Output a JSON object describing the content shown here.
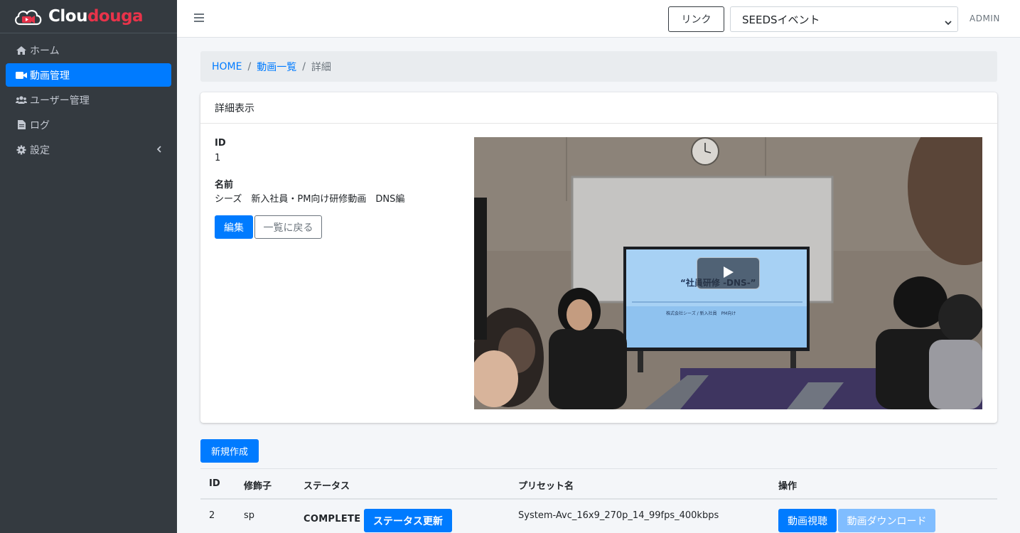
{
  "brand": {
    "name_white": "Clou",
    "name_red": "douga"
  },
  "sidebar": {
    "items": [
      {
        "label": "ホーム",
        "icon": "home-icon",
        "active": false
      },
      {
        "label": "動画管理",
        "icon": "video-camera-icon",
        "active": true
      },
      {
        "label": "ユーザー管理",
        "icon": "users-icon",
        "active": false
      },
      {
        "label": "ログ",
        "icon": "file-icon",
        "active": false
      },
      {
        "label": "設定",
        "icon": "gear-icon",
        "active": false
      }
    ]
  },
  "topbar": {
    "link_label": "リンク",
    "event_select_value": "SEEDSイベント",
    "user_label": "ADMIN"
  },
  "breadcrumb": {
    "home": "HOME",
    "list": "動画一覧",
    "current": "詳細",
    "separator": "/"
  },
  "detail": {
    "card_title": "詳細表示",
    "id_label": "ID",
    "id_value": "1",
    "name_label": "名前",
    "name_value": "シーズ　新入社員・PM向け研修動画　DNS編",
    "edit_label": "編集",
    "back_label": "一覧に戻る",
    "video": {
      "slide_title": "“社員研修 -DNS-”",
      "slide_subtitle": "株式会社シーズ / 新入社員　PM向け"
    }
  },
  "variants": {
    "new_label": "新規作成",
    "columns": [
      "ID",
      "修飾子",
      "ステータス",
      "プリセット名",
      "操作"
    ],
    "rows": [
      {
        "id": "2",
        "modifier": "sp",
        "status": "COMPLETE",
        "status_update_label": "ステータス更新",
        "preset": "System-Avc_16x9_270p_14_99fps_400kbps",
        "watch_label": "動画視聴",
        "download_label": "動画ダウンロード"
      }
    ]
  },
  "colors": {
    "sidebar_bg": "#343a40",
    "primary": "#007bff",
    "brand_red": "#e8334a",
    "disabled_primary": "#80bdff"
  }
}
